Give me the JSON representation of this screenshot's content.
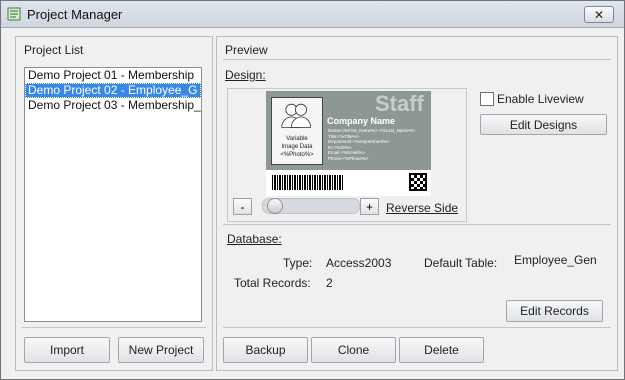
{
  "window": {
    "title": "Project Manager",
    "close_label": "✕"
  },
  "left_panel": {
    "title": "Project List",
    "items": [
      "Demo Project 01 - Membership",
      "Demo Project 02 - Employee_G",
      "Demo Project 03 - Membership_"
    ],
    "import_label": "Import",
    "new_project_label": "New Project"
  },
  "preview": {
    "title": "Preview",
    "design_label": "Design:",
    "card": {
      "staff": "Staff",
      "company": "Company Name",
      "photo_caption": [
        "Variable",
        "Image Data",
        "<%Photo%>"
      ],
      "fields": [
        "Name:<%First_Name%> <%Last_Name%>",
        "Title:<%Title%>",
        "Department:<%Department%>",
        "ID:<%ID%>",
        "Email:<%Email%>",
        "Phone:<%Phone%>"
      ]
    },
    "zoom_minus": "-",
    "zoom_plus": "+",
    "reverse_side": "Reverse Side",
    "enable_liveview": "Enable Liveview",
    "edit_designs": "Edit Designs",
    "database_label": "Database:",
    "type_label": "Type:",
    "type_value": "Access2003",
    "default_table_label": "Default Table:",
    "default_table_value": "Employee_Gen",
    "total_records_label": "Total Records:",
    "total_records_value": "2",
    "edit_records": "Edit Records",
    "backup_label": "Backup",
    "clone_label": "Clone",
    "delete_label": "Delete"
  }
}
